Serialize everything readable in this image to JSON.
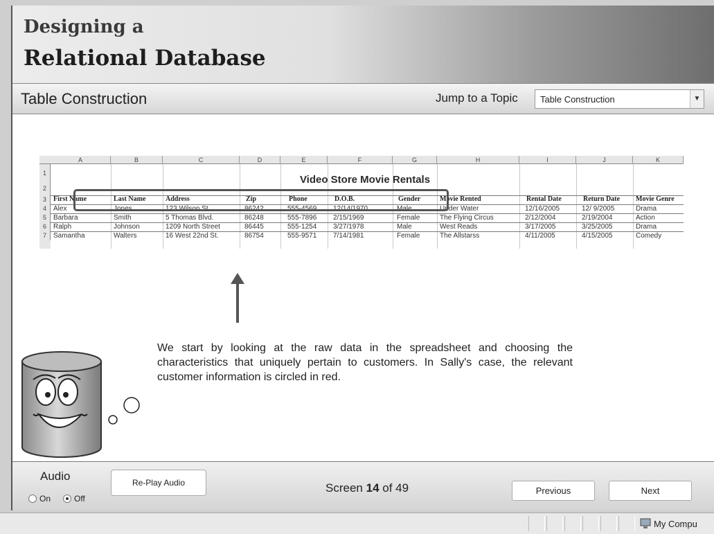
{
  "header": {
    "title_line1": "Designing a",
    "title_line2": "Relational Database"
  },
  "topic_bar": {
    "section_title": "Table Construction",
    "jump_label": "Jump to a Topic",
    "topic_select_value": "Table Construction"
  },
  "spreadsheet": {
    "columns": [
      "A",
      "B",
      "C",
      "D",
      "E",
      "F",
      "G",
      "H",
      "I",
      "J",
      "K"
    ],
    "rows": [
      "1",
      "2",
      "3",
      "4",
      "5",
      "6",
      "7"
    ],
    "title": "Video Store Movie Rentals",
    "headers": [
      "First Name",
      "Last Name",
      "Address",
      "Zip",
      "Phone",
      "D.O.B.",
      "Gender",
      "Movie Rented",
      "Rental Date",
      "Return Date",
      "Movie Genre"
    ],
    "data_rows": [
      [
        "Alex",
        "Jones",
        "123 Wilson St.",
        "86242",
        "555-4569",
        "12/14/1970",
        "Male",
        "Under Water",
        "12/16/2005",
        "12/ 9/2005",
        "Drama"
      ],
      [
        "Barbara",
        "Smith",
        "5 Thomas Blvd.",
        "86248",
        "555-7896",
        "2/15/1969",
        "Female",
        "The Flying Circus",
        "2/12/2004",
        "2/19/2004",
        "Action"
      ],
      [
        "Ralph",
        "Johnson",
        "1209 North Street",
        "86445",
        "555-1254",
        "3/27/1978",
        "Male",
        "West Reads",
        "3/17/2005",
        "3/25/2005",
        "Drama"
      ],
      [
        "Samantha",
        "Walters",
        "16 West 22nd St.",
        "86754",
        "555-9571",
        "7/14/1981",
        "Female",
        "The Allstarss",
        "4/11/2005",
        "4/15/2005",
        "Comedy"
      ]
    ]
  },
  "narration": "We start by looking at the raw data in the spreadsheet and choosing the characteristics that uniquely pertain to customers.  In Sally's case, the relevant customer information is circled in red.",
  "footer": {
    "audio_label": "Audio",
    "audio_on": "On",
    "audio_off": "Off",
    "audio_selected": "Off",
    "replay_label": "Re-Play Audio",
    "screen_prefix": "Screen",
    "screen_current": "14",
    "screen_of": "of 49",
    "previous_label": "Previous",
    "next_label": "Next"
  },
  "statusbar": {
    "zone_label": "My Compu",
    "zone_icon": "computer-icon"
  },
  "colors": {
    "header_gradient_start": "#ececec",
    "header_gradient_end": "#6e6e6e"
  }
}
